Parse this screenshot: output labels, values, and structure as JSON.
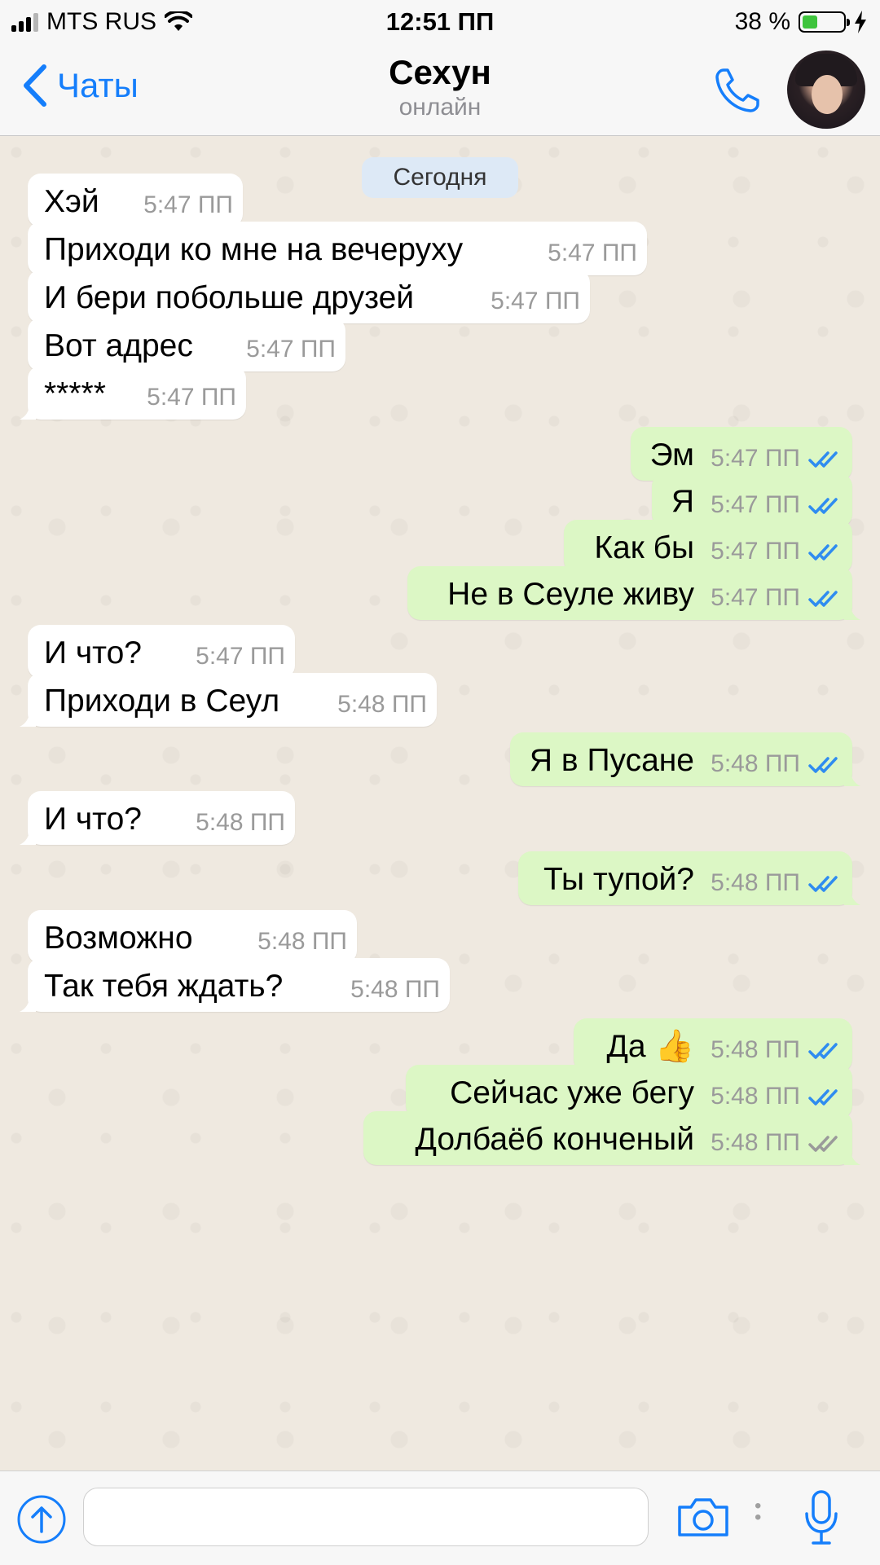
{
  "status_bar": {
    "carrier": "MTS RUS",
    "time": "12:51 ПП",
    "battery": "38 %",
    "battery_level": 0.38,
    "accent_battery_color": "#3ec43c"
  },
  "nav": {
    "back_label": "Чаты",
    "contact_name": "Сехун",
    "contact_status": "онлайн",
    "accent_color": "#157efb",
    "icons": [
      "chevron-left-icon",
      "phone-icon",
      "avatar"
    ]
  },
  "chat": {
    "date_label": "Сегодня",
    "incoming_bubble_color": "#ffffff",
    "outgoing_bubble_color": "#dcf7c5",
    "read_tick_color": "#2f8cf0",
    "unread_tick_color": "#9a9a9a",
    "messages": [
      {
        "dir": "in",
        "text": "Хэй",
        "time": "5:47 ПП"
      },
      {
        "dir": "in",
        "text": "Приходи ко мне на вечеруху",
        "time": "5:47 ПП"
      },
      {
        "dir": "in",
        "text": "И бери побольше друзей",
        "time": "5:47 ПП"
      },
      {
        "dir": "in",
        "text": "Вот адрес",
        "time": "5:47 ПП"
      },
      {
        "dir": "in",
        "text": "*****",
        "time": "5:47 ПП"
      },
      {
        "dir": "out",
        "text": "Эм",
        "time": "5:47 ПП",
        "status": "read"
      },
      {
        "dir": "out",
        "text": "Я",
        "time": "5:47 ПП",
        "status": "read"
      },
      {
        "dir": "out",
        "text": "Как бы",
        "time": "5:47 ПП",
        "status": "read"
      },
      {
        "dir": "out",
        "text": "Не в Сеуле живу",
        "time": "5:47 ПП",
        "status": "read"
      },
      {
        "dir": "in",
        "text": "И что?",
        "time": "5:47 ПП"
      },
      {
        "dir": "in",
        "text": "Приходи в Сеул",
        "time": "5:48 ПП"
      },
      {
        "dir": "out",
        "text": "Я в Пусане",
        "time": "5:48 ПП",
        "status": "read"
      },
      {
        "dir": "in",
        "text": "И что?",
        "time": "5:48 ПП"
      },
      {
        "dir": "out",
        "text": "Ты тупой?",
        "time": "5:48 ПП",
        "status": "read"
      },
      {
        "dir": "in",
        "text": "Возможно",
        "time": "5:48 ПП"
      },
      {
        "dir": "in",
        "text": "Так тебя ждать?",
        "time": "5:48 ПП"
      },
      {
        "dir": "out",
        "text": "Да 👍",
        "time": "5:48 ПП",
        "status": "read"
      },
      {
        "dir": "out",
        "text": "Сейчас уже бегу",
        "time": "5:48 ПП",
        "status": "read"
      },
      {
        "dir": "out",
        "text": "Долбаёб конченый",
        "time": "5:48 ПП",
        "status": "delivered"
      }
    ]
  },
  "input_bar": {
    "placeholder": "",
    "icons": [
      "upload-arrow-icon",
      "camera-icon",
      "more-dots-icon",
      "microphone-icon"
    ]
  }
}
